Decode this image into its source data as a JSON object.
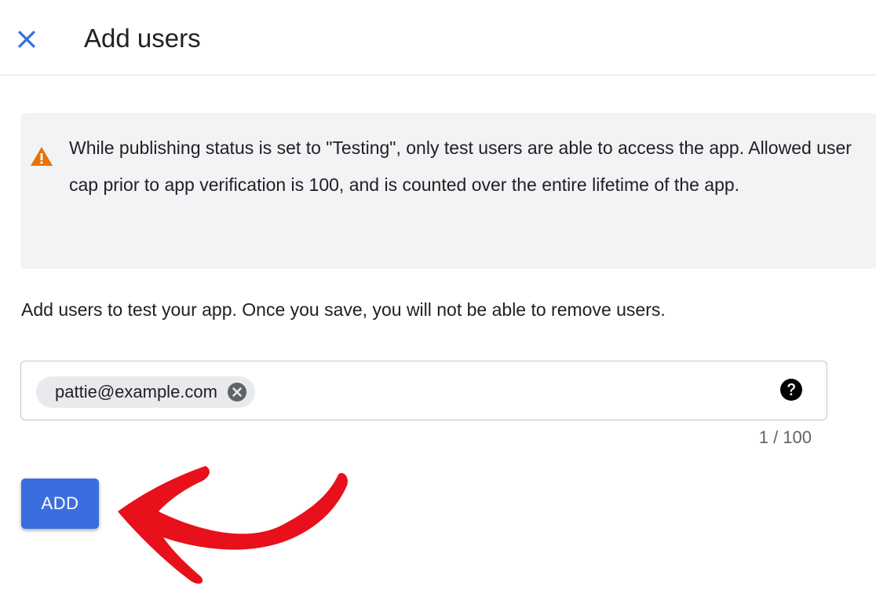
{
  "header": {
    "title": "Add users",
    "close_icon": "close-icon"
  },
  "warning": {
    "icon": "warning-triangle-icon",
    "icon_color": "#e8710a",
    "text": "While publishing status is set to \"Testing\", only test users are able to access the app. Allowed user cap prior to app verification is 100, and is counted over the entire lifetime of the app."
  },
  "instructions": "Add users to test your app. Once you save, you will not be able to remove users.",
  "users_field": {
    "chips": [
      {
        "label": "pattie@example.com"
      }
    ],
    "help_icon": "help-circle-icon",
    "counter": "1 / 100"
  },
  "actions": {
    "add_label": "ADD",
    "accent_color": "#3a6ee0"
  },
  "annotation": {
    "icon": "red-curved-arrow",
    "color": "#e8101a"
  }
}
